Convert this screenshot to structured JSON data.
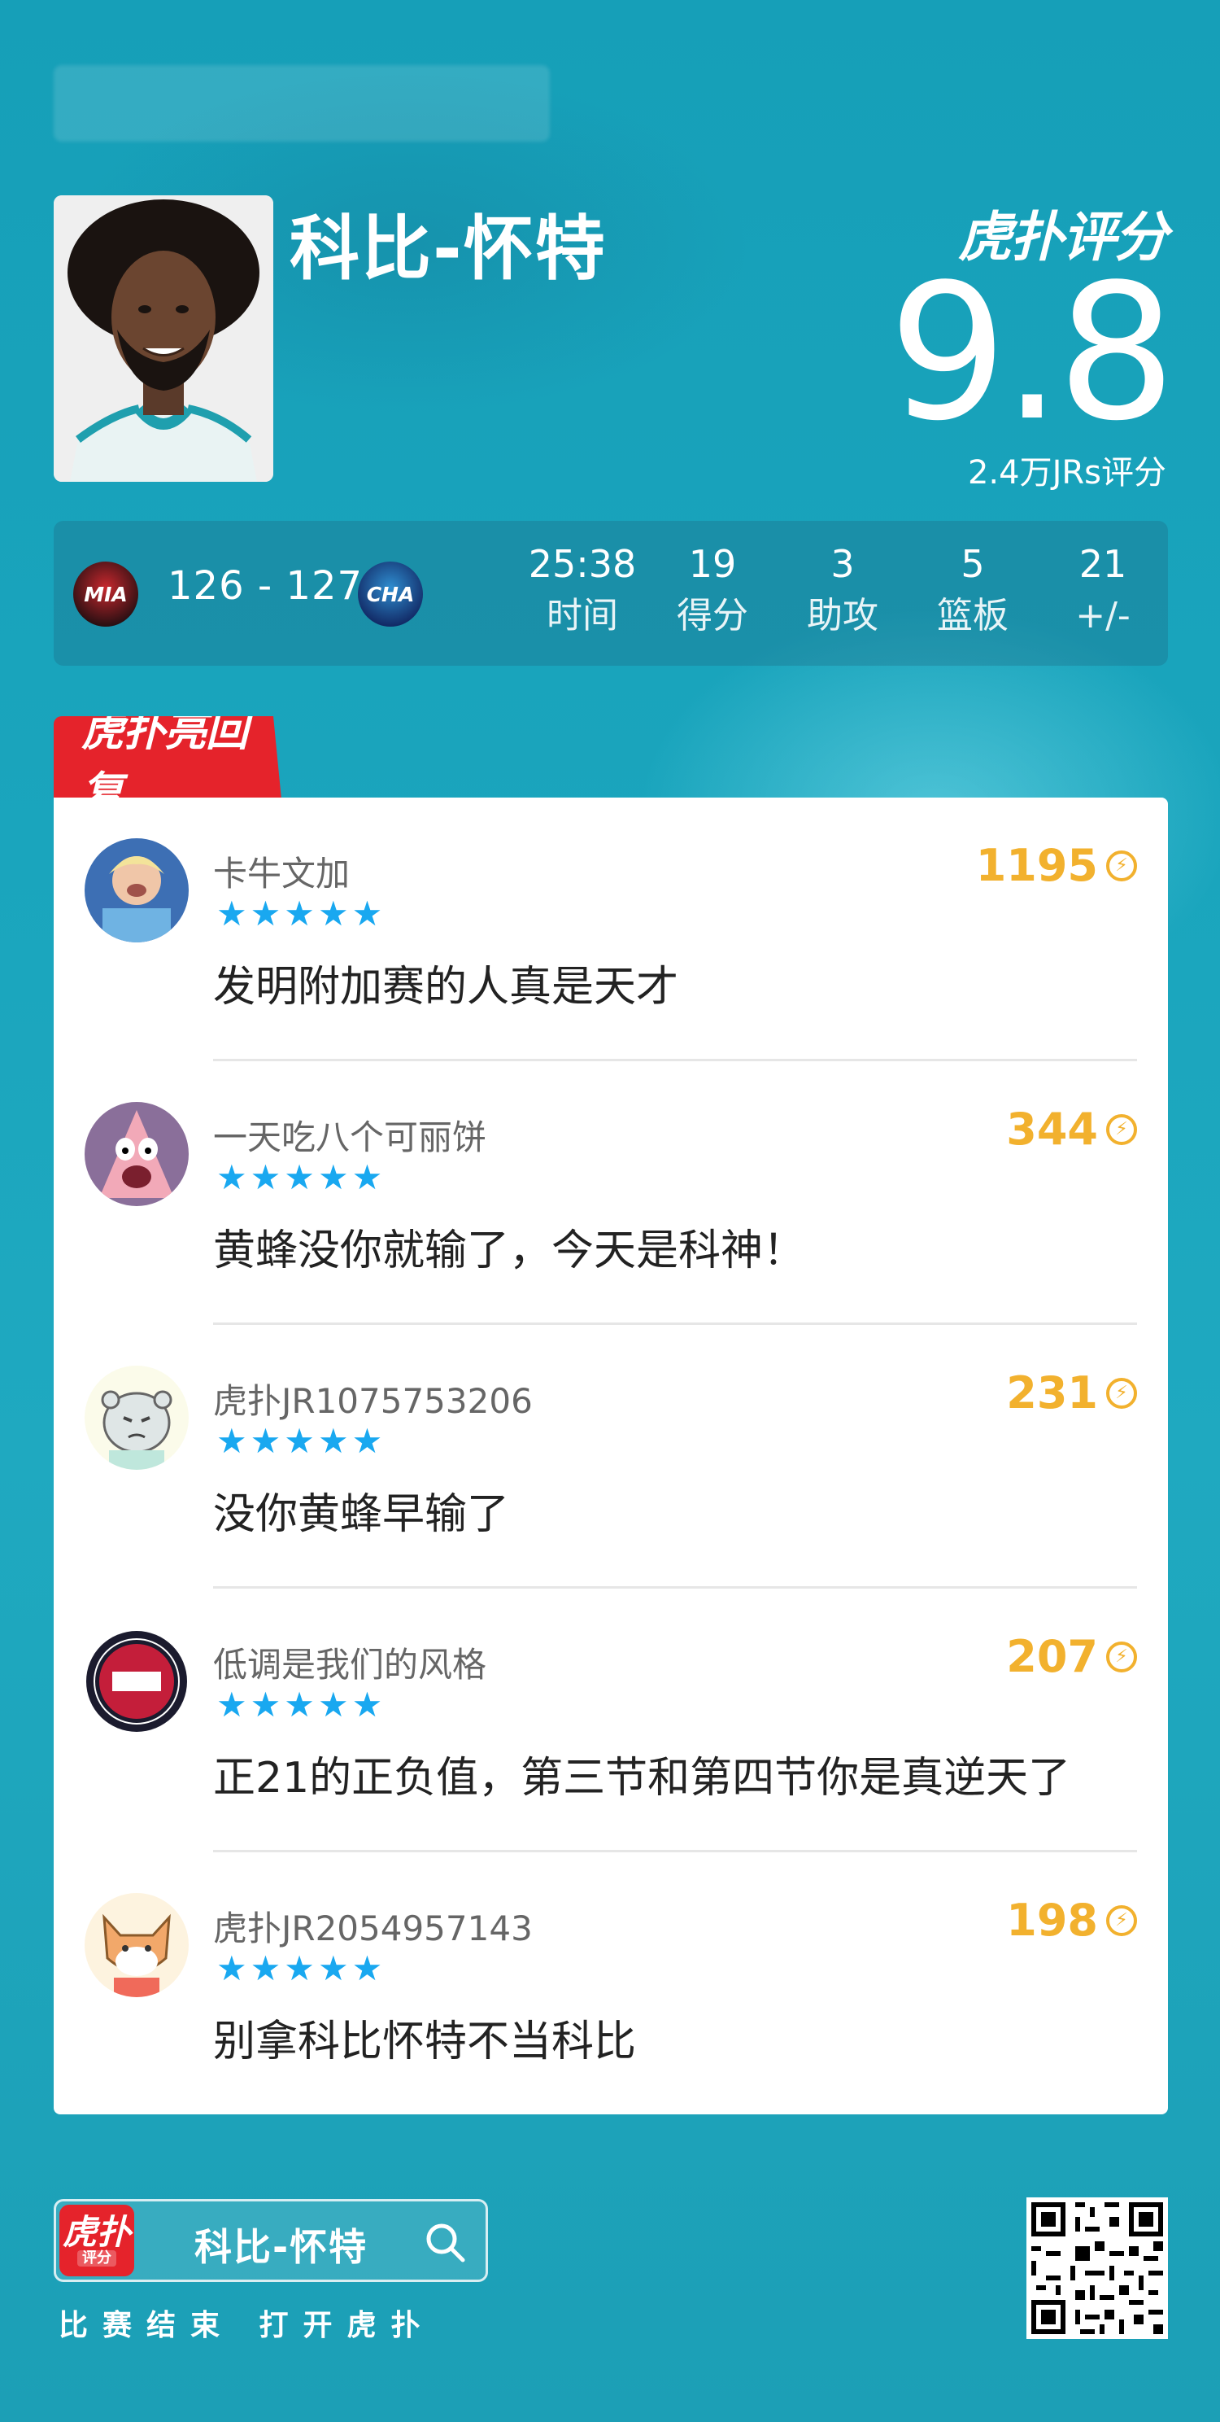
{
  "player": {
    "name": "科比-怀特"
  },
  "rating": {
    "brand": "虎扑评分",
    "score": "9.8",
    "count": "2.4万JRs评分"
  },
  "game": {
    "home_team": "MIA",
    "away_team": "CHA",
    "score": "126 - 127"
  },
  "stats": [
    {
      "value": "25:38",
      "label": "时间"
    },
    {
      "value": "19",
      "label": "得分"
    },
    {
      "value": "3",
      "label": "助攻"
    },
    {
      "value": "5",
      "label": "篮板"
    },
    {
      "value": "21",
      "label": "+/-"
    }
  ],
  "section": {
    "title": "虎扑亮回复"
  },
  "comments": [
    {
      "user": "卡牛文加",
      "stars": "★★★★★",
      "likes": "1195",
      "text": "发明附加赛的人真是天才"
    },
    {
      "user": "一天吃八个可丽饼",
      "stars": "★★★★★",
      "likes": "344",
      "text": "黄蜂没你就输了，今天是科神！"
    },
    {
      "user": "虎扑JR1075753206",
      "stars": "★★★★★",
      "likes": "231",
      "text": "没你黄蜂早输了"
    },
    {
      "user": "低调是我们的风格",
      "stars": "★★★★★",
      "likes": "207",
      "text": "正21的正负值，第三节和第四节你是真逆天了"
    },
    {
      "user": "虎扑JR2054957143",
      "stars": "★★★★★",
      "likes": "198",
      "text": "别拿科比怀特不当科比"
    }
  ],
  "footer": {
    "app_name": "虎扑",
    "app_sub": "评分",
    "search_text": "科比-怀特",
    "caption": "比赛结束 打开虎扑"
  },
  "colors": {
    "accent_red": "#e5232b",
    "star_blue": "#19a8f0",
    "like_gold": "#f2b12e"
  }
}
